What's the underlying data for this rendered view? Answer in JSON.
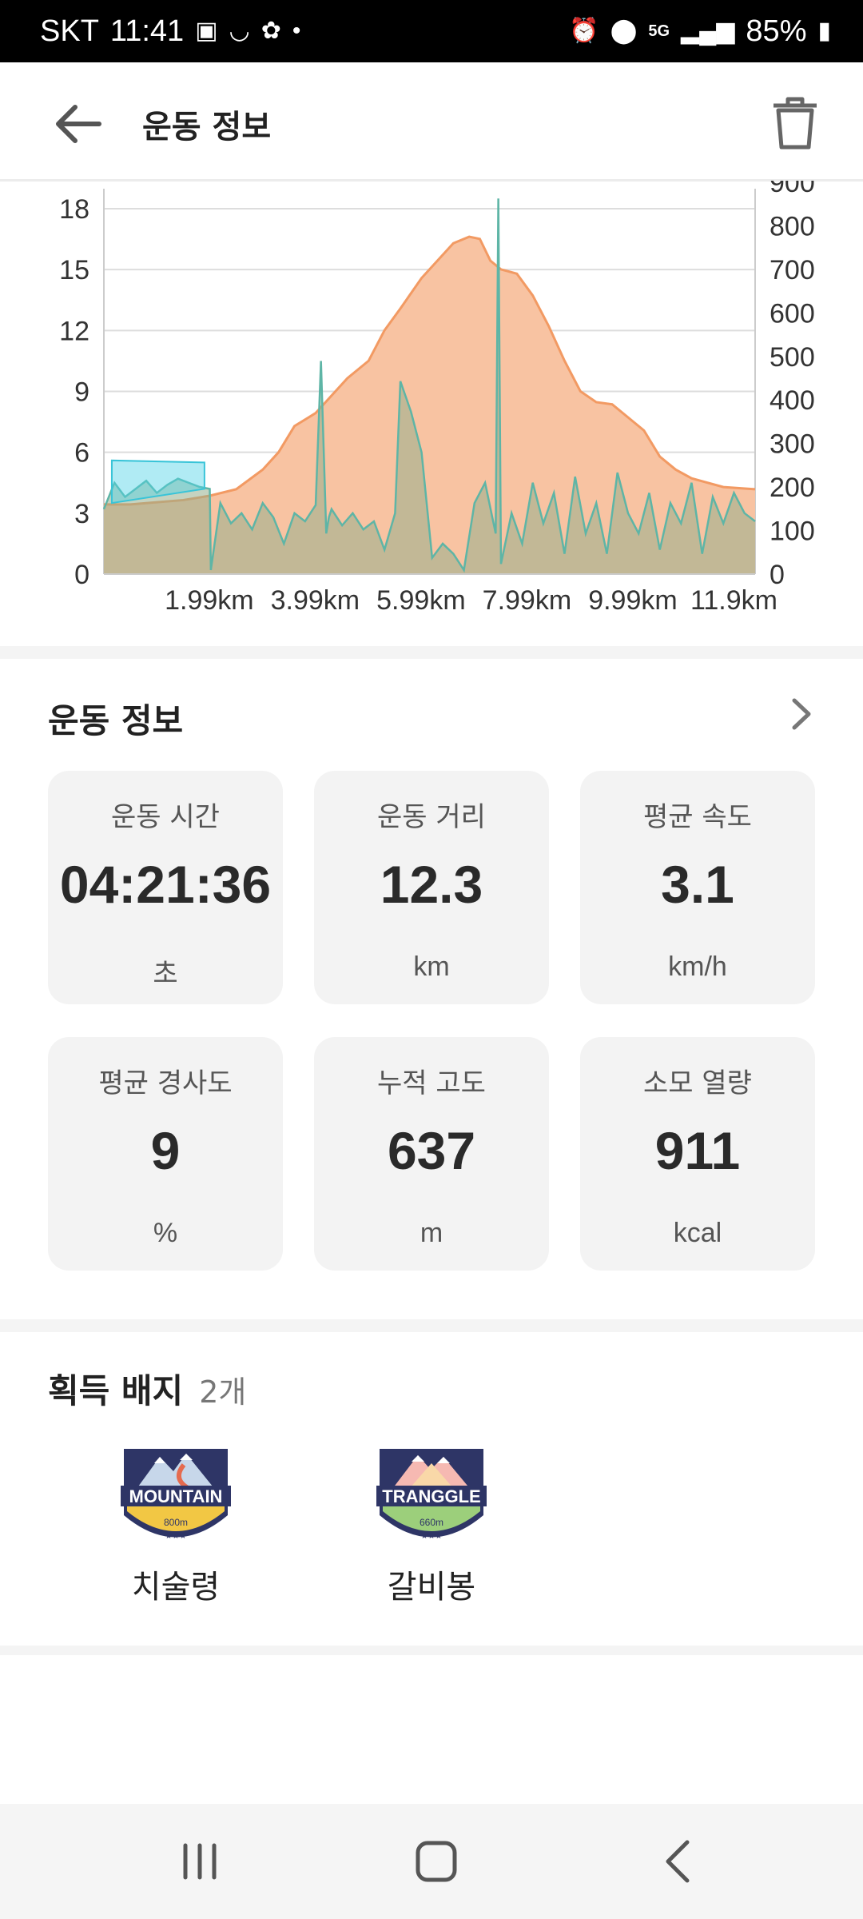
{
  "status_bar": {
    "carrier": "SKT",
    "time": "11:41",
    "network": "5G",
    "battery": "85%"
  },
  "header": {
    "title": "운동 정보",
    "back_icon": "arrow-left-icon",
    "delete_icon": "trash-icon"
  },
  "chart_data": {
    "type": "area",
    "x_ticks": [
      "1.99km",
      "3.99km",
      "5.99km",
      "7.99km",
      "9.99km",
      "11.9km"
    ],
    "left_axis_ticks": [
      "0",
      "3",
      "6",
      "9",
      "12",
      "15",
      "18"
    ],
    "right_axis_ticks": [
      "0",
      "100",
      "200",
      "300",
      "400",
      "500",
      "600",
      "700",
      "800",
      "900"
    ],
    "ylim_left": [
      0,
      20
    ],
    "ylim_right": [
      0,
      900
    ],
    "series": [
      {
        "role": "altitude",
        "axis": "right",
        "color": "#f29a63",
        "fill": "#f8c3a2",
        "x": [
          0,
          0.5,
          1,
          1.5,
          2,
          2.5,
          3,
          3.3,
          3.6,
          4,
          4.3,
          4.6,
          5,
          5.3,
          5.6,
          6,
          6.3,
          6.6,
          6.9,
          7.1,
          7.3,
          7.5,
          7.8,
          8.1,
          8.4,
          8.7,
          9,
          9.3,
          9.6,
          9.9,
          10.2,
          10.5,
          10.8,
          11.1,
          11.4,
          11.7,
          12.3
        ],
        "y": [
          160,
          160,
          165,
          170,
          180,
          195,
          240,
          280,
          340,
          370,
          410,
          450,
          490,
          560,
          610,
          680,
          720,
          760,
          775,
          770,
          720,
          700,
          690,
          640,
          570,
          490,
          420,
          395,
          390,
          360,
          330,
          270,
          240,
          220,
          210,
          200,
          195
        ]
      },
      {
        "role": "speed",
        "axis": "left",
        "color": "#5eb5a6",
        "fill": "rgba(150,175,140,0.55)",
        "x": [
          0,
          0.2,
          0.4,
          0.6,
          0.8,
          1,
          1.2,
          1.4,
          1.6,
          1.8,
          2.0,
          2.02,
          2.2,
          2.4,
          2.6,
          2.8,
          3,
          3.2,
          3.4,
          3.6,
          3.8,
          4.0,
          4.1,
          4.2,
          4.25,
          4.3,
          4.5,
          4.7,
          4.9,
          5.1,
          5.3,
          5.5,
          5.6,
          5.8,
          6.0,
          6.2,
          6.4,
          6.6,
          6.8,
          7.0,
          7.2,
          7.4,
          7.45,
          7.5,
          7.7,
          7.9,
          8.1,
          8.3,
          8.5,
          8.7,
          8.9,
          9.1,
          9.3,
          9.5,
          9.7,
          9.9,
          10.1,
          10.3,
          10.5,
          10.7,
          10.9,
          11.1,
          11.3,
          11.5,
          11.7,
          11.9,
          12.1,
          12.3
        ],
        "y": [
          3.2,
          4.5,
          3.8,
          4.2,
          4.6,
          4.0,
          4.4,
          4.7,
          4.5,
          4.3,
          4.2,
          0.2,
          3.5,
          2.5,
          3.0,
          2.2,
          3.5,
          2.8,
          1.5,
          3.0,
          2.6,
          3.4,
          10.5,
          2.0,
          2.8,
          3.2,
          2.4,
          3.0,
          2.2,
          2.6,
          1.2,
          3.0,
          9.5,
          8.0,
          6.0,
          0.8,
          1.5,
          1.0,
          0.2,
          3.5,
          4.5,
          2.0,
          18.5,
          0.5,
          3.0,
          1.5,
          4.5,
          2.5,
          4.0,
          1.0,
          4.8,
          2.0,
          3.5,
          1.0,
          5.0,
          3.0,
          2.0,
          4.0,
          1.2,
          3.5,
          2.5,
          4.5,
          1.0,
          3.8,
          2.5,
          4.0,
          3.0,
          2.6
        ]
      }
    ]
  },
  "exercise_info": {
    "title": "운동 정보",
    "more_icon": "chevron-right-icon",
    "stats": [
      {
        "label": "운동 시간",
        "value": "04:21:36",
        "unit": "초"
      },
      {
        "label": "운동 거리",
        "value": "12.3",
        "unit": "km"
      },
      {
        "label": "평균 속도",
        "value": "3.1",
        "unit": "km/h"
      },
      {
        "label": "평균 경사도",
        "value": "9",
        "unit": "%"
      },
      {
        "label": "누적 고도",
        "value": "637",
        "unit": "m"
      },
      {
        "label": "소모 열량",
        "value": "911",
        "unit": "kcal"
      }
    ]
  },
  "badges": {
    "title": "획득 배지",
    "count": "2개",
    "items": [
      {
        "name": "치술령",
        "emblem_text": "MOUNTAIN",
        "sub_text": "800m",
        "color": "#f2c744"
      },
      {
        "name": "갈비봉",
        "emblem_text": "TRANGGLE",
        "sub_text": "660m",
        "color": "#9ccf7b"
      }
    ]
  },
  "nav_bar": {
    "recent_icon": "recent-apps-icon",
    "home_icon": "home-icon",
    "back_icon": "back-icon"
  }
}
